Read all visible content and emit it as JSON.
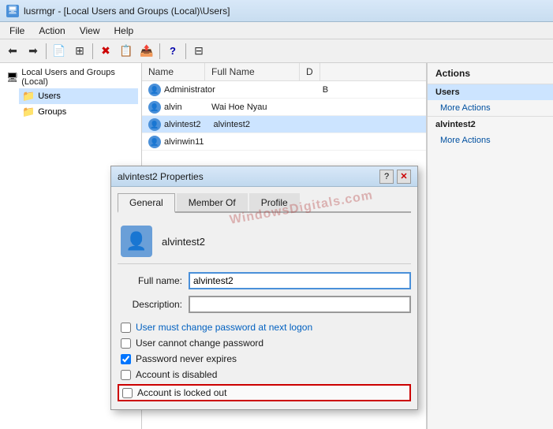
{
  "titleBar": {
    "icon": "🖥",
    "title": "lusrmgr - [Local Users and Groups (Local)\\Users]"
  },
  "menuBar": {
    "items": [
      "File",
      "Action",
      "View",
      "Help"
    ]
  },
  "toolbar": {
    "buttons": [
      "←",
      "→",
      "📄",
      "⊞",
      "✖",
      "📋",
      "📤",
      "?",
      "⊟"
    ]
  },
  "treePanel": {
    "root": "Local Users and Groups (Local)",
    "children": [
      "Users",
      "Groups"
    ]
  },
  "listPanel": {
    "columns": [
      "Name",
      "Full Name",
      "D"
    ],
    "rows": [
      {
        "name": "Administrator",
        "fullName": "",
        "d": "B",
        "icon": "👤"
      },
      {
        "name": "alvin",
        "fullName": "Wai Hoe Nyau",
        "d": "",
        "icon": "👤"
      },
      {
        "name": "alvintest2",
        "fullName": "alvintest2",
        "d": "",
        "icon": "👤",
        "selected": true
      },
      {
        "name": "alvinwin11",
        "fullName": "",
        "d": "",
        "icon": "👤"
      }
    ]
  },
  "actionsPanel": {
    "header": "Actions",
    "sections": [
      {
        "title": "Users",
        "items": [
          "More Actions"
        ]
      },
      {
        "title": "alvintest2",
        "items": [
          "More Actions"
        ]
      }
    ]
  },
  "dialog": {
    "title": "alvintest2 Properties",
    "tabs": [
      "General",
      "Member Of",
      "Profile"
    ],
    "activeTab": "General",
    "userName": "alvintest2",
    "fields": {
      "fullNameLabel": "Full name:",
      "fullNameValue": "alvintest2",
      "descriptionLabel": "Description:",
      "descriptionValue": ""
    },
    "checkboxes": [
      {
        "label": "User must change password at next logon",
        "checked": false,
        "blue": true
      },
      {
        "label": "User cannot change password",
        "checked": false,
        "blue": false
      },
      {
        "label": "Password never expires",
        "checked": true,
        "blue": false
      },
      {
        "label": "Account is disabled",
        "checked": false,
        "blue": false
      }
    ],
    "lockedOut": {
      "label": "Account is locked out",
      "checked": false,
      "highlighted": true
    }
  },
  "watermark": "WindowsDigitals.com"
}
